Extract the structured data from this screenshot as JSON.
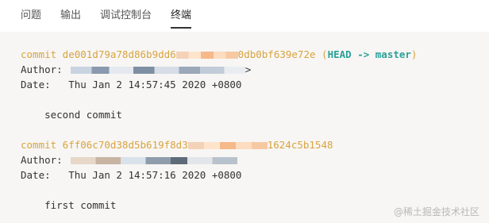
{
  "tabs": [
    {
      "label": "问题",
      "active": false
    },
    {
      "label": "输出",
      "active": false
    },
    {
      "label": "调试控制台",
      "active": false
    },
    {
      "label": "终端",
      "active": true
    }
  ],
  "terminal": {
    "commit1": {
      "prefix": "commit de001d79a78d86b9dd6",
      "suffix": "0db0bf639e72e",
      "head_open": " (",
      "head": "HEAD -> master",
      "head_close": ")",
      "author_label": "Author:",
      "author_tail": ">",
      "date": "Date:   Thu Jan 2 14:57:45 2020 +0800",
      "message": "    second commit"
    },
    "commit2": {
      "prefix": "commit 6ff06c70d38d5b619f8d3",
      "suffix": "1624c5b1548",
      "author_label": "Author:",
      "date": "Date:   Thu Jan 2 14:57:16 2020 +0800",
      "message": "    first commit"
    }
  },
  "watermark": "@稀土掘金技术社区",
  "colors": {
    "commit_hash": "#d9a33f",
    "head_ref": "#2aa198",
    "terminal_bg": "#f7f6f4"
  }
}
